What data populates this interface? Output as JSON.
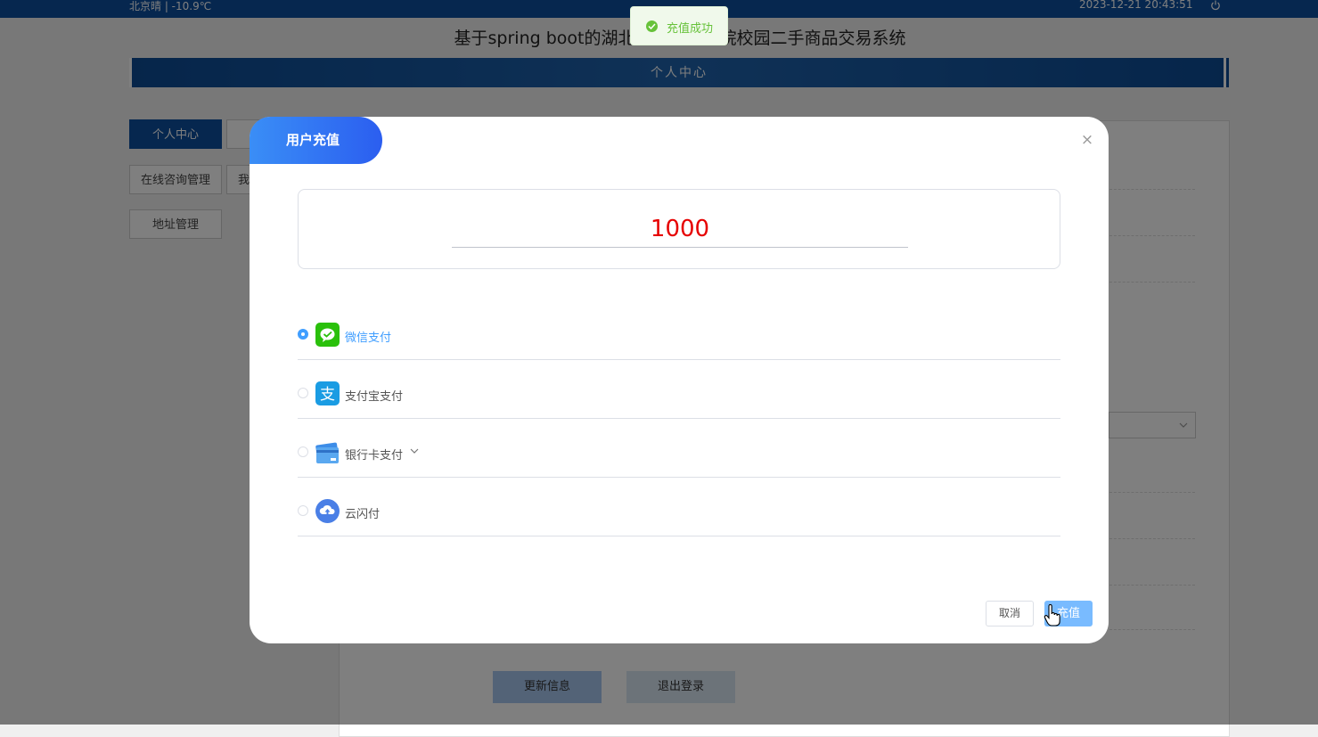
{
  "topbar": {
    "weather": "北京晴 | -10.9℃",
    "datetime": "2023-12-21  20:43:51",
    "power_icon": "power-icon"
  },
  "site_title": "基于spring boot的湖北汽车工业学院校园二手商品交易系统",
  "banner_title": "个人中心",
  "side_nav": {
    "items": [
      "个人中心",
      "在线咨询管理",
      "我",
      "地址管理"
    ]
  },
  "bottom_buttons": {
    "update": "更新信息",
    "logout": "退出登录"
  },
  "toast": {
    "text": "充值成功",
    "icon": "success-check-icon",
    "color": "#67c23a"
  },
  "dialog": {
    "title": "用户充值",
    "close_icon": "close-icon",
    "amount": "1000",
    "payment_methods": [
      {
        "label": "微信支付",
        "icon": "wechat-pay-icon",
        "selected": true
      },
      {
        "label": "支付宝支付",
        "icon": "alipay-icon",
        "selected": false
      },
      {
        "label": "银行卡支付",
        "icon": "bank-card-icon",
        "selected": false,
        "has_dropdown": true
      },
      {
        "label": "云闪付",
        "icon": "cloud-quickpass-icon",
        "selected": false
      }
    ],
    "cancel_label": "取消",
    "confirm_label": "充值"
  },
  "colors": {
    "primary": "#0d4f9f",
    "accent": "#409eff",
    "amount": "#e60000"
  }
}
